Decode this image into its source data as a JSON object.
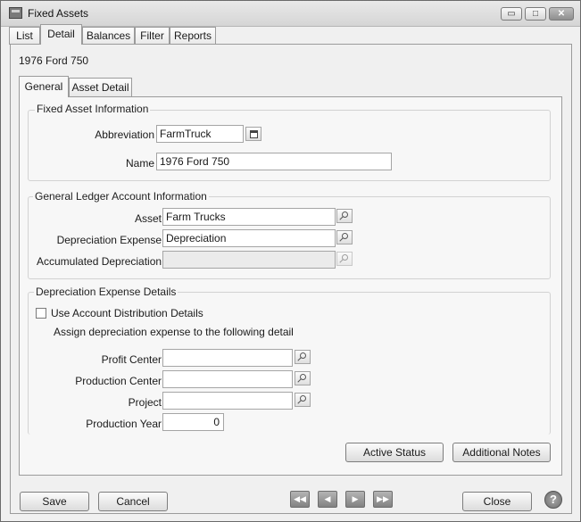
{
  "window": {
    "title": "Fixed Assets",
    "icon": "fixed-assets-app-icon",
    "controls": {
      "minimize": "▭",
      "maximize": "□",
      "close": "✕"
    }
  },
  "tabs": [
    "List",
    "Detail",
    "Balances",
    "Filter",
    "Reports"
  ],
  "active_tab": "Detail",
  "record_title": "1976 Ford 750",
  "subtabs": [
    "General",
    "Asset Detail"
  ],
  "active_subtab": "General",
  "fixed_asset_info": {
    "group_title": "Fixed Asset Information",
    "abbreviation_label": "Abbreviation",
    "abbreviation_value": "FarmTruck",
    "name_label": "Name",
    "name_value": "1976 Ford 750"
  },
  "gl_info": {
    "group_title": "General Ledger Account Information",
    "asset_label": "Asset",
    "asset_value": "Farm Trucks",
    "depreciation_expense_label": "Depreciation Expense",
    "depreciation_expense_value": "Depreciation",
    "accumulated_depreciation_label": "Accumulated Depreciation",
    "accumulated_depreciation_value": ""
  },
  "depreciation_details": {
    "group_title": "Depreciation Expense Details",
    "use_distribution_label": "Use Account Distribution Details",
    "use_distribution_checked": false,
    "assign_text": "Assign depreciation expense to the following detail",
    "profit_center_label": "Profit Center",
    "profit_center_value": "",
    "production_center_label": "Production Center",
    "production_center_value": "",
    "project_label": "Project",
    "project_value": "",
    "production_year_label": "Production Year",
    "production_year_value": "0"
  },
  "buttons": {
    "active_status": "Active Status",
    "additional_notes": "Additional Notes",
    "save": "Save",
    "cancel": "Cancel",
    "close": "Close",
    "help": "?",
    "nav_first": "◀◀",
    "nav_prev": "◀",
    "nav_next": "▶",
    "nav_last": "▶▶"
  }
}
